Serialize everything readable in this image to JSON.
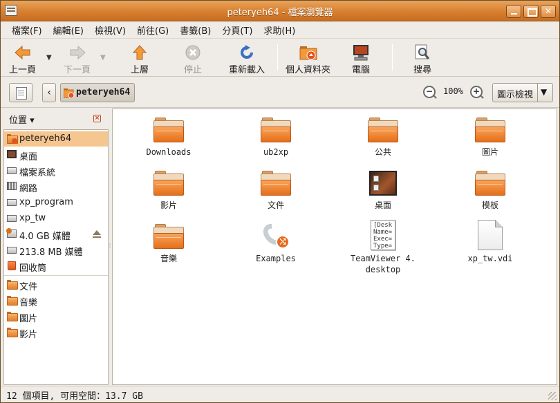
{
  "window": {
    "title": "peteryeh64 - 檔案瀏覽器"
  },
  "menubar": {
    "items": [
      "檔案(F)",
      "編輯(E)",
      "檢視(V)",
      "前往(G)",
      "書籤(B)",
      "分頁(T)",
      "求助(H)"
    ]
  },
  "toolbar": {
    "back": "上一頁",
    "forward": "下一頁",
    "up": "上層",
    "stop": "停止",
    "reload": "重新載入",
    "home": "個人資料夾",
    "computer": "電腦",
    "search": "搜尋"
  },
  "location": {
    "path": "peteryeh64",
    "zoom": "100%",
    "view_mode": "圖示檢視"
  },
  "sidebar": {
    "header": "位置",
    "items": [
      {
        "label": "peteryeh64",
        "icon": "home-folder-icon"
      },
      {
        "label": "桌面",
        "icon": "desktop-icon"
      },
      {
        "label": "檔案系統",
        "icon": "drive-icon"
      },
      {
        "label": "網路",
        "icon": "network-icon"
      },
      {
        "label": "xp_program",
        "icon": "drive-icon"
      },
      {
        "label": "xp_tw",
        "icon": "drive-icon"
      },
      {
        "label": "4.0 GB 媒體",
        "icon": "usb-media-icon"
      },
      {
        "label": "213.8 MB 媒體",
        "icon": "drive-icon"
      },
      {
        "label": "回收筒",
        "icon": "trash-icon"
      },
      {
        "label": "文件",
        "icon": "folder-icon"
      },
      {
        "label": "音樂",
        "icon": "folder-icon"
      },
      {
        "label": "圖片",
        "icon": "folder-icon"
      },
      {
        "label": "影片",
        "icon": "folder-icon"
      }
    ]
  },
  "files": [
    {
      "name": "Downloads",
      "type": "folder"
    },
    {
      "name": "ub2xp",
      "type": "folder"
    },
    {
      "name": "公共",
      "type": "folder"
    },
    {
      "name": "圖片",
      "type": "folder"
    },
    {
      "name": "影片",
      "type": "folder"
    },
    {
      "name": "文件",
      "type": "folder"
    },
    {
      "name": "桌面",
      "type": "desktop-folder"
    },
    {
      "name": "模板",
      "type": "folder"
    },
    {
      "name": "音樂",
      "type": "folder"
    },
    {
      "name": "Examples",
      "type": "symlink"
    },
    {
      "name": "TeamViewer 4.\ndesktop",
      "type": "desktop-file",
      "preview": "[Desk\nName=\nExec=\nType="
    },
    {
      "name": "xp_tw.vdi",
      "type": "file"
    }
  ],
  "statusbar": {
    "text": "12 個項目, 可用空間：13.7 GB"
  }
}
